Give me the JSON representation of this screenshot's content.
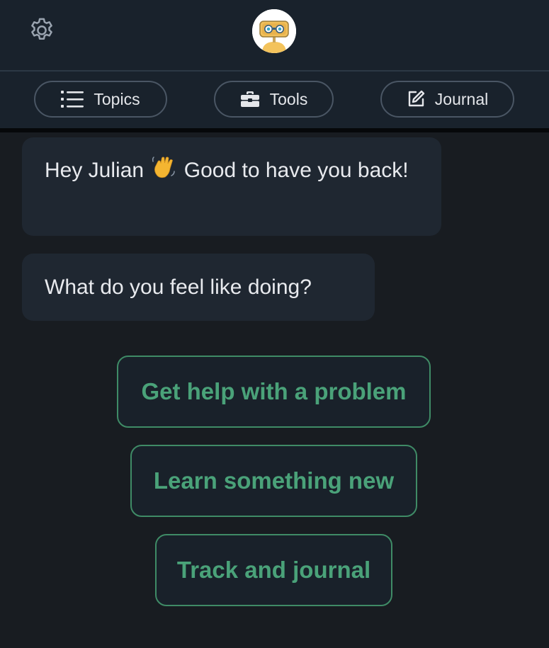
{
  "header": {
    "settings_icon": "gear-icon",
    "avatar_icon": "robot-avatar"
  },
  "nav": {
    "topics_label": "Topics",
    "tools_label": "Tools",
    "journal_label": "Journal"
  },
  "chat": {
    "greeting_before_emoji": "Hey Julian",
    "greeting_emoji": "waving-hand-emoji",
    "greeting_after_emoji": "Good to have you back!",
    "question": "What do you feel like doing?"
  },
  "options": {
    "option_1": "Get help with a problem",
    "option_2": "Learn something new",
    "option_3": "Track and journal"
  },
  "colors": {
    "background": "#181c21",
    "bar": "#19222c",
    "bubble": "#1f2731",
    "accent_green": "#4aa279",
    "avatar_yellow": "#f3c35c"
  }
}
